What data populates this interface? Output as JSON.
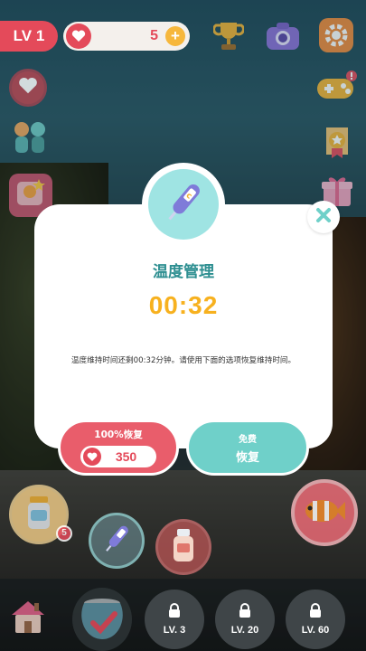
{
  "hud": {
    "level": "LV 1",
    "hearts_count": "5",
    "plus_label": "+"
  },
  "dialog": {
    "title": "温度管理",
    "timer": "00:32",
    "description": "温度维持时间还剩00:32分钟。请使用下面的选项恢复维持时间。",
    "pay_button": {
      "label": "100%恢复",
      "price": "350"
    },
    "free_button": {
      "line1": "免费",
      "line2": "恢复"
    }
  },
  "side": {
    "left_slot_badge": "5"
  },
  "bottom_nav": {
    "slots": [
      {
        "label": "LV. 3"
      },
      {
        "label": "LV. 20"
      },
      {
        "label": "LV. 60"
      }
    ]
  },
  "colors": {
    "accent_red": "#e44a5a",
    "accent_teal": "#6fd0c9",
    "title_teal": "#2e8f91",
    "timer_gold": "#f7b11f"
  },
  "icons": [
    "heart-icon",
    "trophy-icon",
    "camera-icon",
    "gear-icon",
    "gamepad-icon",
    "medal-icon",
    "gift-icon",
    "thermometer-icon",
    "close-icon",
    "fish-food-icon",
    "clownfish-icon",
    "house-icon",
    "fishbowl-icon",
    "lock-icon"
  ]
}
